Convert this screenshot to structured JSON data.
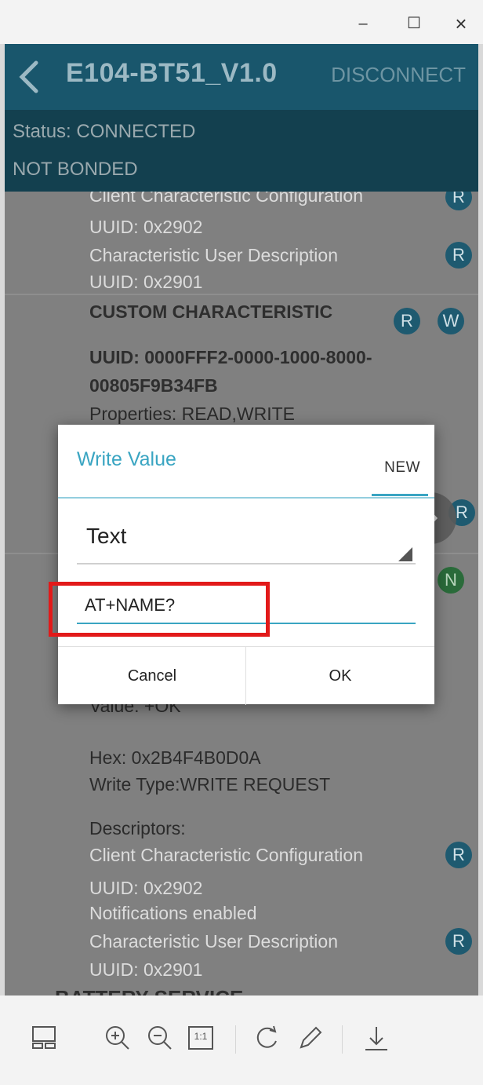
{
  "window": {
    "minimize_glyph": "–",
    "maximize_glyph": "☐",
    "close_glyph": "×"
  },
  "appbar": {
    "title": "E104-BT51_V1.0",
    "disconnect_label": "DISCONNECT"
  },
  "status": {
    "connection": "Status: CONNECTED",
    "bond": "NOT BONDED"
  },
  "content": {
    "top_partial": "Client Characteristic Configuration",
    "uuid_2902_top": "UUID: 0x2902",
    "char_user_desc_top": "Characteristic User Description",
    "uuid_2901_top": "UUID: 0x2901",
    "custom_char_heading": "CUSTOM CHARACTERISTIC",
    "custom_uuid_line1": "UUID: 0000FFF2-0000-1000-8000-",
    "custom_uuid_line2": "00805F9B34FB",
    "custom_properties": "Properties: READ,WRITE",
    "value_partial": "Value: +OK",
    "hex": "Hex: 0x2B4F4B0D0A",
    "write_type": "Write Type:WRITE REQUEST",
    "descriptors": "Descriptors:",
    "ccc": "Client Characteristic Configuration",
    "uuid_2902": "UUID: 0x2902",
    "notifications": "Notifications enabled",
    "cud": "Characteristic User Description",
    "uuid_2901": "UUID: 0x2901",
    "battery_partial": "BATTERY SERVICE",
    "badge_r": "R",
    "badge_w": "W",
    "badge_n": "N"
  },
  "dialog": {
    "title": "Write Value",
    "tab_new": "NEW",
    "format_selected": "Text",
    "input_value": "AT+NAME?",
    "cancel_label": "Cancel",
    "ok_label": "OK"
  },
  "toolbar": {
    "fit_label": "1:1"
  },
  "colors": {
    "appbar": "#19566c",
    "statusbar": "#13404f",
    "accent": "#3aa5c2",
    "highlight": "#e21a1a"
  }
}
